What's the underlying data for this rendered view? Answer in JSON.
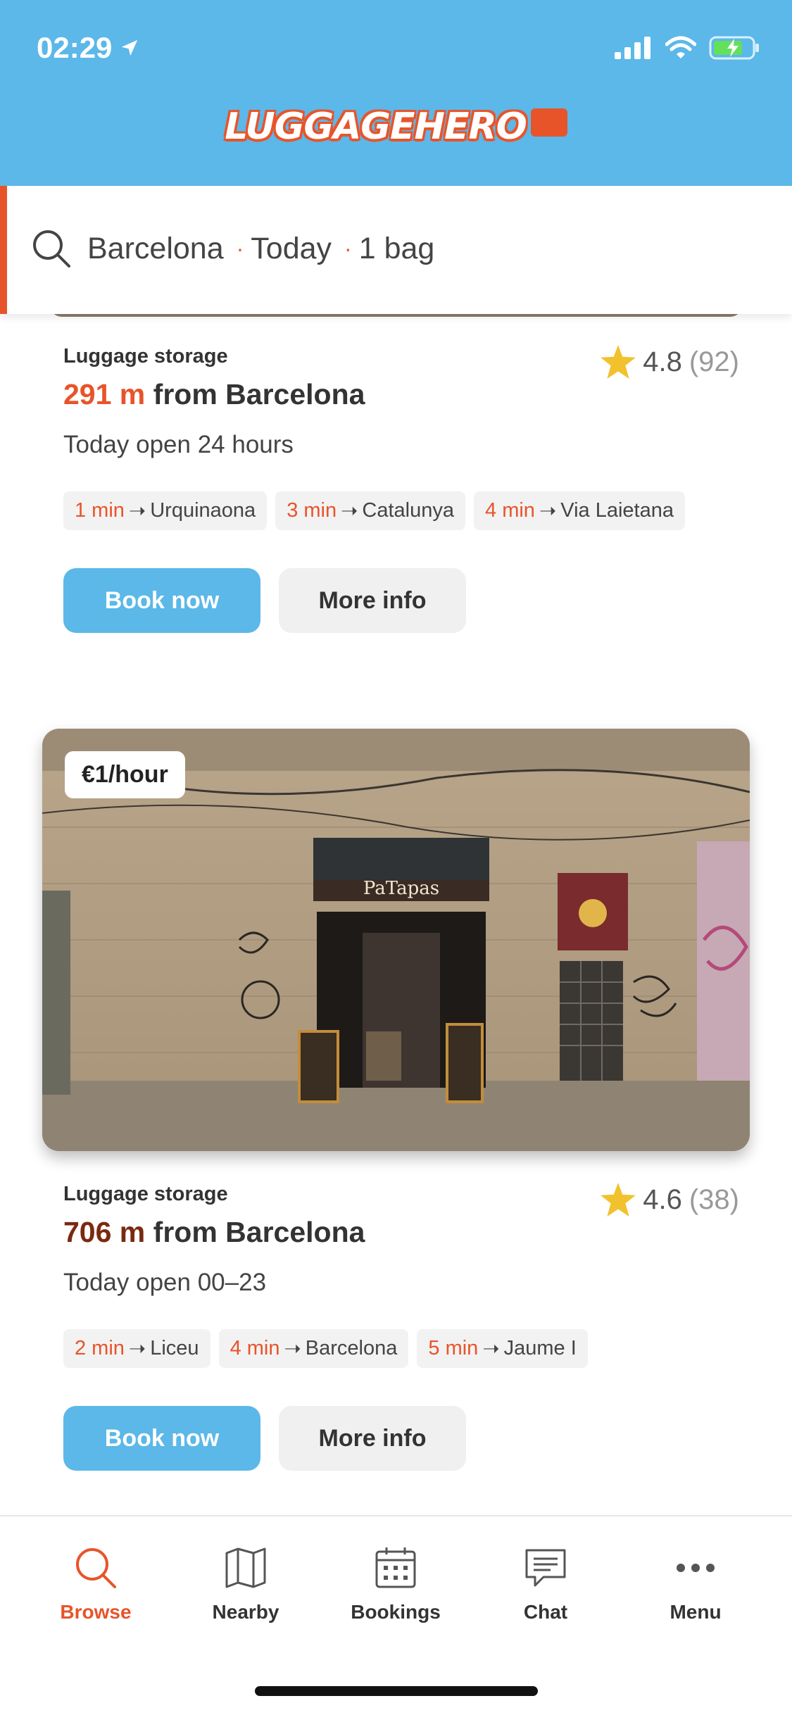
{
  "status": {
    "time": "02:29"
  },
  "brand": {
    "logo_text": "LUGGAGEHERO"
  },
  "search": {
    "city": "Barcelona",
    "day": "Today",
    "bags": "1 bag"
  },
  "listings": [
    {
      "type": "Luggage storage",
      "distance_value": "291 m",
      "distance_suffix": "from Barcelona",
      "hours": "Today open 24 hours",
      "rating": "4.8",
      "reviews": "(92)",
      "chips": [
        {
          "min": "1 min",
          "station": "Urquinaona"
        },
        {
          "min": "3 min",
          "station": "Catalunya"
        },
        {
          "min": "4 min",
          "station": "Via Laietana"
        }
      ],
      "book_label": "Book now",
      "more_label": "More info"
    },
    {
      "price": "€1/hour",
      "shop_sign": "PaTapas",
      "type": "Luggage storage",
      "distance_value": "706 m",
      "distance_suffix": "from Barcelona",
      "hours": "Today open 00–23",
      "rating": "4.6",
      "reviews": "(38)",
      "chips": [
        {
          "min": "2 min",
          "station": "Liceu"
        },
        {
          "min": "4 min",
          "station": "Barcelona"
        },
        {
          "min": "5 min",
          "station": "Jaume I"
        }
      ],
      "book_label": "Book now",
      "more_label": "More info"
    }
  ],
  "tabs": [
    {
      "label": "Browse",
      "icon": "search-icon",
      "active": true
    },
    {
      "label": "Nearby",
      "icon": "map-icon"
    },
    {
      "label": "Bookings",
      "icon": "calendar-icon"
    },
    {
      "label": "Chat",
      "icon": "chat-icon"
    },
    {
      "label": "Menu",
      "icon": "more-icon"
    }
  ],
  "colors": {
    "brand_blue": "#5bb8e8",
    "accent_orange": "#e8542a"
  }
}
